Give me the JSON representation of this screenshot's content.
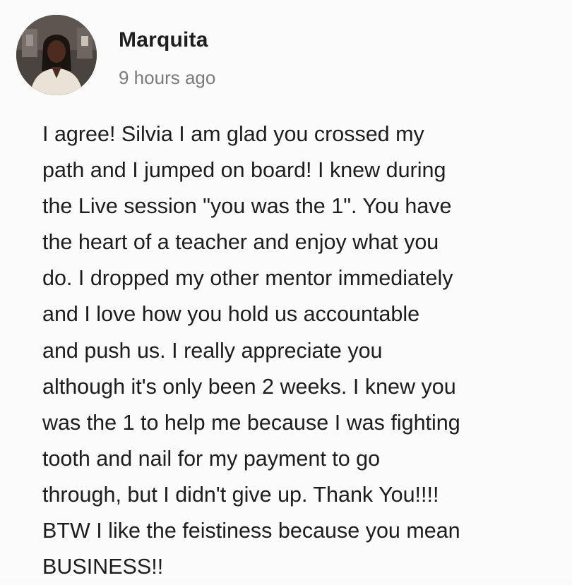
{
  "comment": {
    "author": "Marquita",
    "timestamp": "9 hours ago",
    "avatar_icon": "user-photo-avatar",
    "lines": [
      "I agree! Silvia I am glad you crossed my",
      "path and I jumped on board! I knew during",
      "the Live session \"you was the 1\". You have",
      "the heart of a teacher and enjoy what you",
      "do. I dropped my other mentor immediately",
      "and I love how you hold us accountable",
      "and push us. I really appreciate you",
      "although it's only been 2 weeks. I knew you",
      "was the 1 to help me because I was fighting",
      "tooth and nail for my payment to go",
      "through, but I didn't give up. Thank You!!!!",
      "BTW I like the feistiness because you mean",
      "BUSINESS!!"
    ]
  },
  "colors": {
    "background": "#fbfbfb",
    "text": "#1d1d1d",
    "timestamp": "#7b7b7b"
  }
}
